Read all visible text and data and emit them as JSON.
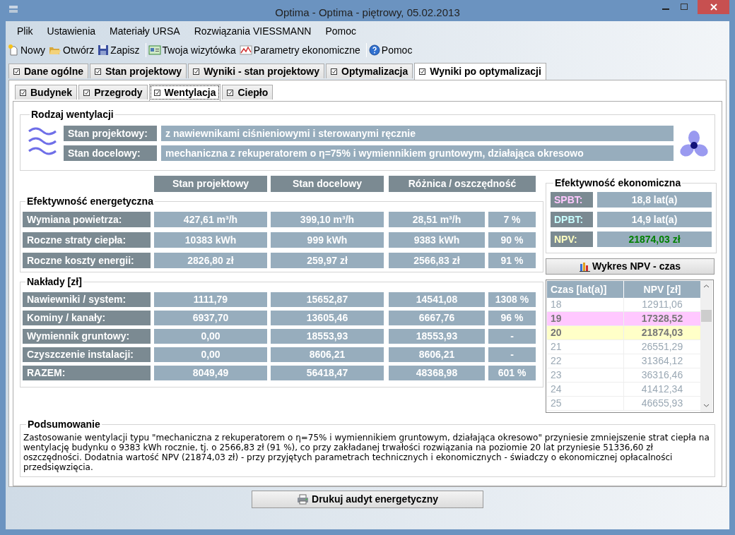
{
  "window": {
    "title": "Optima - Optima - piętrowy, 05.02.2013"
  },
  "menu": [
    "Plik",
    "Ustawienia",
    "Materiały URSA",
    "Rozwiązania VIESSMANN",
    "Pomoc"
  ],
  "toolbar_groups": [
    [
      {
        "label": "Nowy",
        "kind": "new"
      },
      {
        "label": "Otwórz",
        "kind": "open"
      },
      {
        "label": "Zapisz",
        "kind": "save"
      }
    ],
    [
      {
        "label": "Twoja wizytówka",
        "kind": "card"
      },
      {
        "label": "Parametry ekonomiczne",
        "kind": "chart"
      }
    ],
    [
      {
        "label": "Pomoc",
        "kind": "help"
      }
    ]
  ],
  "tabs": [
    {
      "label": "Dane ogólne",
      "selected": false
    },
    {
      "label": "Stan projektowy",
      "selected": false
    },
    {
      "label": "Wyniki - stan projektowy",
      "selected": false
    },
    {
      "label": "Optymalizacja",
      "selected": false
    },
    {
      "label": "Wyniki po optymalizacji",
      "selected": true
    }
  ],
  "subtabs": [
    {
      "label": "Budynek",
      "selected": false
    },
    {
      "label": "Przegrody",
      "selected": false
    },
    {
      "label": "Wentylacja",
      "selected": true
    },
    {
      "label": "Ciepło",
      "selected": false
    }
  ],
  "ventilation": {
    "title": "Rodzaj wentylacji",
    "rows": [
      {
        "label": "Stan projektowy:",
        "value": "z nawiewnikami ciśnieniowymi i sterowanymi ręcznie"
      },
      {
        "label": "Stan docelowy:",
        "value": "mechaniczna z rekuperatorem o η=75% i wymiennikiem gruntowym, działająca okresowo"
      }
    ]
  },
  "columns": [
    "Stan projektowy",
    "Stan docelowy",
    "Różnica / oszczędność"
  ],
  "energy": {
    "title": "Efektywność energetyczna",
    "rows": [
      {
        "label": "Wymiana powietrza:",
        "values": [
          "427,61 m³/h",
          "399,10 m³/h",
          "28,51 m³/h",
          "7 %"
        ]
      },
      {
        "label": "Roczne straty ciepła:",
        "values": [
          "10383 kWh",
          "999 kWh",
          "9383 kWh",
          "90 %"
        ]
      },
      {
        "label": "Roczne koszty energii:",
        "values": [
          "2826,80 zł",
          "259,97 zł",
          "2566,83 zł",
          "91 %"
        ]
      }
    ]
  },
  "costs": {
    "title": "Nakłady [zł]",
    "rows": [
      {
        "label": "Nawiewniki / system:",
        "values": [
          "1111,79",
          "15652,87",
          "14541,08",
          "1308 %"
        ]
      },
      {
        "label": "Kominy / kanały:",
        "values": [
          "6937,70",
          "13605,46",
          "6667,76",
          "96 %"
        ]
      },
      {
        "label": "Wymiennik gruntowy:",
        "values": [
          "0,00",
          "18553,93",
          "18553,93",
          "-"
        ]
      },
      {
        "label": "Czyszczenie instalacji:",
        "values": [
          "0,00",
          "8606,21",
          "8606,21",
          "-"
        ]
      },
      {
        "label": "RAZEM:",
        "values": [
          "8049,49",
          "56418,47",
          "48368,98",
          "601 %"
        ]
      }
    ]
  },
  "economic": {
    "title": "Efektywność ekonomiczna",
    "rows": [
      {
        "label": "SPBT:",
        "value": "18,8 lat(a)",
        "kind": "spbt"
      },
      {
        "label": "DPBT:",
        "value": "14,9 lat(a)",
        "kind": "dpbt"
      },
      {
        "label": "NPV:",
        "value": "21874,03 zł",
        "kind": "npv"
      }
    ]
  },
  "npv_button": "Wykres NPV - czas",
  "npv_table": {
    "columns": [
      "Czas [lat(a)]",
      "NPV [zł]"
    ],
    "rows": [
      {
        "year": "18",
        "npv": "12911,06"
      },
      {
        "year": "19",
        "npv": "17328,52",
        "color": "#ffc8ff"
      },
      {
        "year": "20",
        "npv": "21874,03",
        "color": "#ffffc8"
      },
      {
        "year": "21",
        "npv": "26551,29"
      },
      {
        "year": "22",
        "npv": "31364,12"
      },
      {
        "year": "23",
        "npv": "36316,46"
      },
      {
        "year": "24",
        "npv": "41412,34"
      },
      {
        "year": "25",
        "npv": "46655,93"
      }
    ]
  },
  "summary": {
    "title": "Podsumowanie",
    "text": "Zastosowanie wentylacji typu \"mechaniczna z rekuperatorem o η=75% i wymiennikiem gruntowym, działająca okresowo\" przyniesie zmniejszenie strat ciepła na wentylację budynku o 9383 kWh rocznie, tj. o 2566,83 zł (91 %), co przy zakładanej trwałości rozwiązania na poziomie 20 lat przyniesie 51336,60 zł oszczędności. Dodatnia wartość NPV (21874,03 zł) - przy przyjętych parametrach technicznych i ekonomicznych - świadczy o ekonomicznej opłacalności przedsięwzięcia."
  },
  "print_button": "Drukuj audyt energetyczny"
}
